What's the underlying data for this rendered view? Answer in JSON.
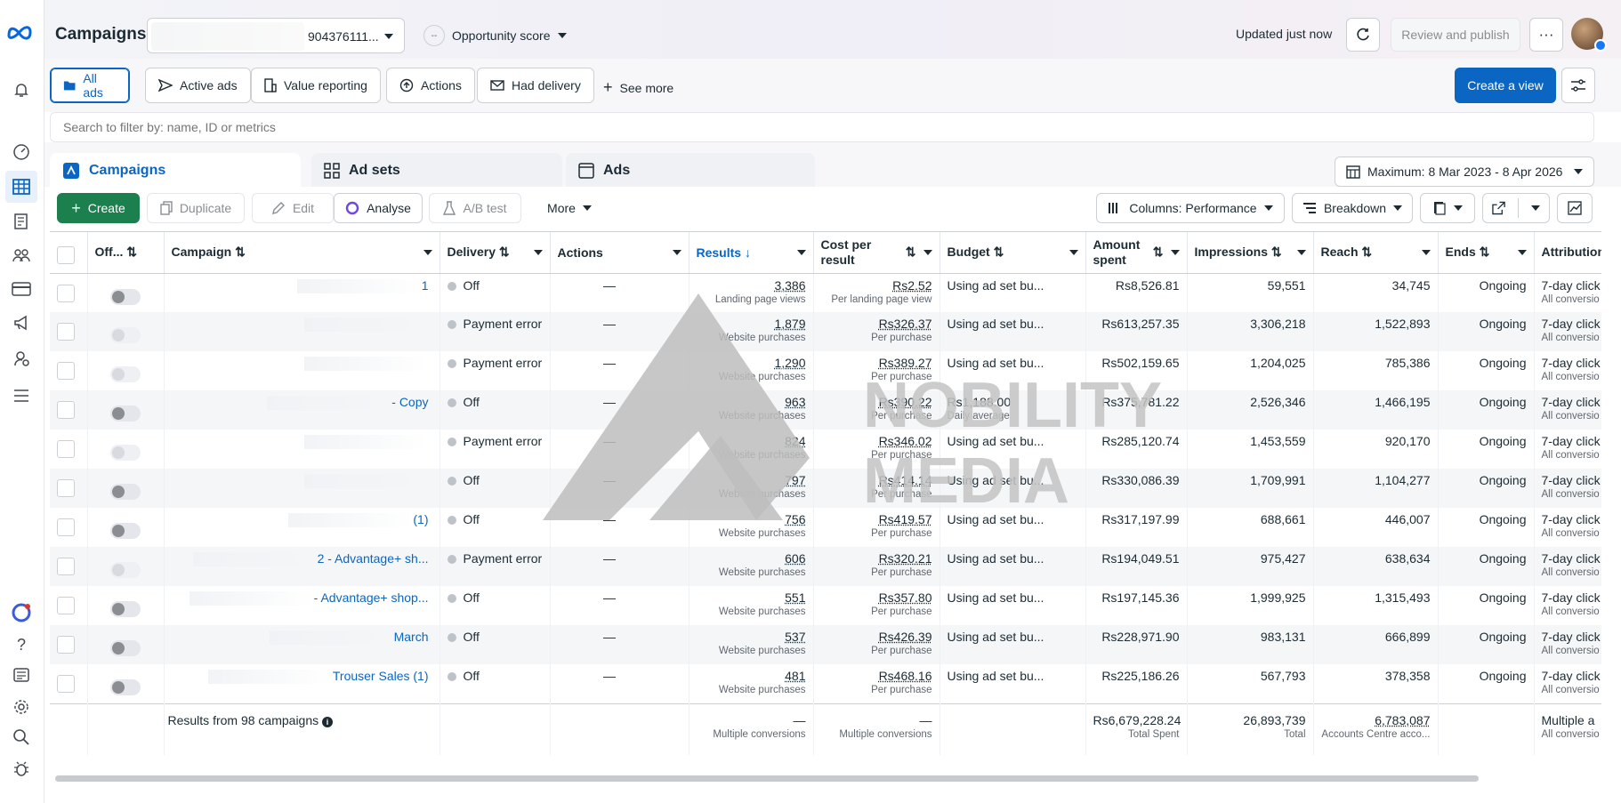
{
  "header": {
    "title": "Campaigns",
    "account_text": "904376111...",
    "opportunity_label": "Opportunity score",
    "opportunity_score": "--",
    "updated_text": "Updated just now",
    "review_label": "Review and publish",
    "more_label": "···"
  },
  "views": {
    "chips": [
      {
        "label": "All ads"
      },
      {
        "label": "Active ads"
      },
      {
        "label": "Value reporting"
      },
      {
        "label": "Actions"
      },
      {
        "label": "Had delivery"
      }
    ],
    "see_more": "See more",
    "create_view": "Create a view"
  },
  "search": {
    "placeholder": "Search to filter by: name, ID or metrics"
  },
  "levels": {
    "campaigns": "Campaigns",
    "adsets": "Ad sets",
    "ads": "Ads",
    "date_range": "Maximum: 8 Mar 2023 - 8 Apr 2026"
  },
  "toolbar": {
    "create": "Create",
    "duplicate": "Duplicate",
    "edit": "Edit",
    "analyse": "Analyse",
    "ab_test": "A/B test",
    "more": "More",
    "columns": "Columns: Performance",
    "breakdown": "Breakdown"
  },
  "table": {
    "headers": {
      "offon": "Off...",
      "campaign": "Campaign",
      "delivery": "Delivery",
      "actions": "Actions",
      "results": "Results",
      "cost": "Cost per result",
      "budget": "Budget",
      "amount": "Amount spent",
      "impressions": "Impressions",
      "reach": "Reach",
      "ends": "Ends",
      "attribution": "Attribution setting"
    },
    "rows": [
      {
        "name": "1",
        "delivery": "Off",
        "actions": "—",
        "results": "3,386",
        "results_sub": "Landing page views",
        "cost": "Rs2.52",
        "cost_sub": "Per landing page view",
        "budget": "Using ad set bu...",
        "budget_sub": "",
        "amount": "Rs8,526.81",
        "impressions": "59,551",
        "reach": "34,745",
        "ends": "Ongoing",
        "attr": "7-day click",
        "attr_sub": "All conversio"
      },
      {
        "name": "",
        "delivery": "Payment error",
        "actions": "—",
        "results": "1,879",
        "results_sub": "Website purchases",
        "cost": "Rs326.37",
        "cost_sub": "Per purchase",
        "budget": "Using ad set bu...",
        "budget_sub": "",
        "amount": "Rs613,257.35",
        "impressions": "3,306,218",
        "reach": "1,522,893",
        "ends": "Ongoing",
        "attr": "7-day click",
        "attr_sub": "All conversio"
      },
      {
        "name": "",
        "delivery": "Payment error",
        "actions": "—",
        "results": "1,290",
        "results_sub": "Website purchases",
        "cost": "Rs389.27",
        "cost_sub": "Per purchase",
        "budget": "Using ad set bu...",
        "budget_sub": "",
        "amount": "Rs502,159.65",
        "impressions": "1,204,025",
        "reach": "785,386",
        "ends": "Ongoing",
        "attr": "7-day click",
        "attr_sub": "All conversio"
      },
      {
        "name": "- Copy",
        "delivery": "Off",
        "actions": "—",
        "results": "963",
        "results_sub": "Website purchases",
        "cost": "Rs390.22",
        "cost_sub": "Per purchase",
        "budget": "Rs1,188.00",
        "budget_sub": "Daily average",
        "amount": "Rs375,781.22",
        "impressions": "2,526,346",
        "reach": "1,466,195",
        "ends": "Ongoing",
        "attr": "7-day click",
        "attr_sub": "All conversio"
      },
      {
        "name": "",
        "delivery": "Payment error",
        "actions": "—",
        "results": "824",
        "results_sub": "Website purchases",
        "cost": "Rs346.02",
        "cost_sub": "Per purchase",
        "budget": "Using ad set bu...",
        "budget_sub": "",
        "amount": "Rs285,120.74",
        "impressions": "1,453,559",
        "reach": "920,170",
        "ends": "Ongoing",
        "attr": "7-day click",
        "attr_sub": "All conversio"
      },
      {
        "name": "",
        "delivery": "Off",
        "actions": "—",
        "results": "797",
        "results_sub": "Website purchases",
        "cost": "Rs414.14",
        "cost_sub": "Per purchase",
        "budget": "Using ad set bu...",
        "budget_sub": "",
        "amount": "Rs330,086.39",
        "impressions": "1,709,991",
        "reach": "1,104,277",
        "ends": "Ongoing",
        "attr": "7-day click",
        "attr_sub": "All conversio"
      },
      {
        "name": "(1)",
        "delivery": "Off",
        "actions": "—",
        "results": "756",
        "results_sub": "Website purchases",
        "cost": "Rs419.57",
        "cost_sub": "Per purchase",
        "budget": "Using ad set bu...",
        "budget_sub": "",
        "amount": "Rs317,197.99",
        "impressions": "688,661",
        "reach": "446,007",
        "ends": "Ongoing",
        "attr": "7-day click",
        "attr_sub": "All conversio"
      },
      {
        "name": "2 - Advantage+ sh...",
        "delivery": "Payment error",
        "actions": "—",
        "results": "606",
        "results_sub": "Website purchases",
        "cost": "Rs320.21",
        "cost_sub": "Per purchase",
        "budget": "Using ad set bu...",
        "budget_sub": "",
        "amount": "Rs194,049.51",
        "impressions": "975,427",
        "reach": "638,634",
        "ends": "Ongoing",
        "attr": "7-day click",
        "attr_sub": "All conversio"
      },
      {
        "name": "- Advantage+ shop...",
        "delivery": "Off",
        "actions": "—",
        "results": "551",
        "results_sub": "Website purchases",
        "cost": "Rs357.80",
        "cost_sub": "Per purchase",
        "budget": "Using ad set bu...",
        "budget_sub": "",
        "amount": "Rs197,145.36",
        "impressions": "1,999,925",
        "reach": "1,315,493",
        "ends": "Ongoing",
        "attr": "7-day click",
        "attr_sub": "All conversio"
      },
      {
        "name": "March",
        "delivery": "Off",
        "actions": "—",
        "results": "537",
        "results_sub": "Website purchases",
        "cost": "Rs426.39",
        "cost_sub": "Per purchase",
        "budget": "Using ad set bu...",
        "budget_sub": "",
        "amount": "Rs228,971.90",
        "impressions": "983,131",
        "reach": "666,899",
        "ends": "Ongoing",
        "attr": "7-day click",
        "attr_sub": "All conversio"
      },
      {
        "name": "Trouser Sales (1)",
        "delivery": "Off",
        "actions": "—",
        "results": "481",
        "results_sub": "Website purchases",
        "cost": "Rs468.16",
        "cost_sub": "Per purchase",
        "budget": "Using ad set bu...",
        "budget_sub": "",
        "amount": "Rs225,186.26",
        "impressions": "567,793",
        "reach": "378,358",
        "ends": "Ongoing",
        "attr": "7-day click",
        "attr_sub": "All conversio"
      }
    ],
    "footer": {
      "label": "Results from 98 campaigns",
      "results": "—",
      "results_sub": "Multiple conversions",
      "cost": "—",
      "cost_sub": "Multiple conversions",
      "amount": "Rs6,679,228.24",
      "amount_sub": "Total Spent",
      "impressions": "26,893,739",
      "impressions_sub": "Total",
      "reach": "6,783,087",
      "reach_sub": "Accounts Centre acco...",
      "attr": "Multiple a",
      "attr_sub": "All conversio"
    }
  },
  "watermark": {
    "line1": "NOBILITY",
    "line2": "MEDIA"
  }
}
